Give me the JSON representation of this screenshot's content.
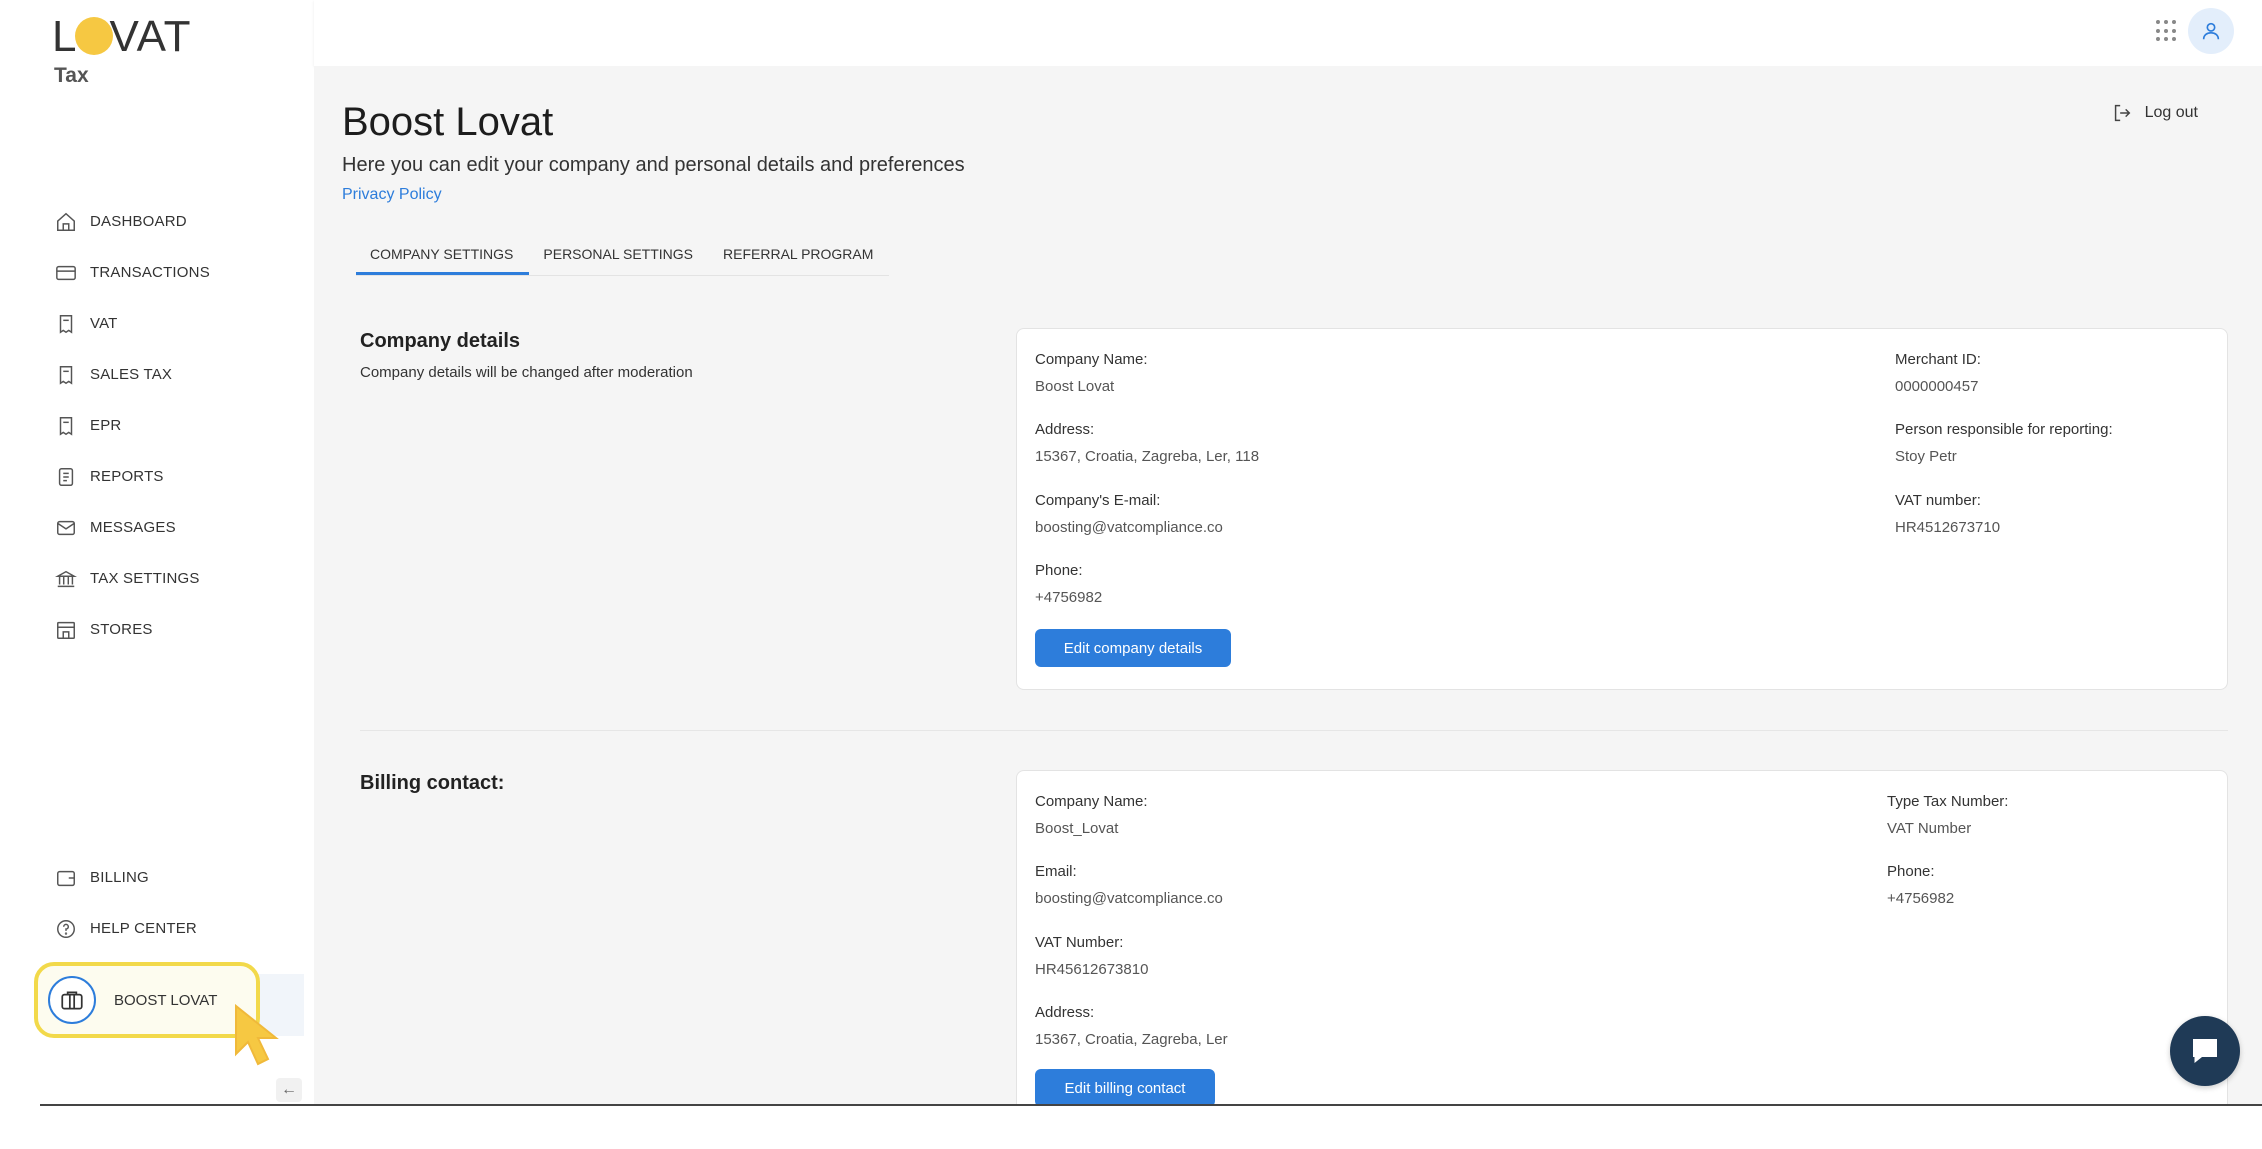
{
  "brand": {
    "logo_text_left": "L",
    "logo_text_right": "VAT",
    "product": "Tax",
    "accent": "#2d7ddb",
    "logo_color": "#f6c842"
  },
  "sidebar": {
    "items": [
      {
        "label": "DASHBOARD",
        "icon": "home-icon"
      },
      {
        "label": "TRANSACTIONS",
        "icon": "card-icon"
      },
      {
        "label": "VAT",
        "icon": "vat-receipt-icon"
      },
      {
        "label": "SALES TAX",
        "icon": "tax-receipt-icon"
      },
      {
        "label": "EPR",
        "icon": "epr-receipt-icon"
      },
      {
        "label": "REPORTS",
        "icon": "document-icon"
      },
      {
        "label": "MESSAGES",
        "icon": "envelope-icon"
      },
      {
        "label": "TAX SETTINGS",
        "icon": "bank-icon"
      },
      {
        "label": "STORES",
        "icon": "store-icon"
      }
    ],
    "bottom_items": [
      {
        "label": "BILLING",
        "icon": "wallet-icon"
      },
      {
        "label": "HELP CENTER",
        "icon": "help-icon"
      }
    ],
    "profile": {
      "label": "BOOST LOVAT",
      "icon": "briefcase-icon"
    },
    "collapse_icon": "arrow-left-icon",
    "collapse_glyph": "←"
  },
  "topbar": {
    "apps_icon": "apps-grid-icon",
    "avatar_icon": "user-icon"
  },
  "page": {
    "title": "Boost Lovat",
    "subtitle": "Here you can edit your company and personal details and preferences",
    "privacy_link": "Privacy Policy",
    "logout": "Log out"
  },
  "tabs": [
    {
      "label": "COMPANY SETTINGS",
      "active": true
    },
    {
      "label": "PERSONAL SETTINGS",
      "active": false
    },
    {
      "label": "REFERRAL PROGRAM",
      "active": false
    }
  ],
  "company": {
    "title": "Company details",
    "description": "Company details will be changed after moderation",
    "fields": {
      "name_label": "Company Name:",
      "name": "Boost Lovat",
      "address_label": "Address:",
      "address": "15367, Croatia, Zagreba, Ler, 118",
      "email_label": "Company's E-mail:",
      "email": "boosting@vatcompliance.co",
      "phone_label": "Phone:",
      "phone": "+4756982",
      "merchant_label": "Merchant ID:",
      "merchant": "0000000457",
      "person_label": "Person responsible for reporting:",
      "person": "Stoy Petr",
      "vat_label": "VAT number:",
      "vat": "HR4512673710"
    },
    "edit_button": "Edit company details"
  },
  "billing": {
    "title": "Billing contact:",
    "fields": {
      "name_label": "Company Name:",
      "name": "Boost_Lovat",
      "email_label": "Email:",
      "email": "boosting@vatcompliance.co",
      "vat_label": "VAT Number:",
      "vat": "HR45612673810",
      "address_label": "Address:",
      "address": "15367, Croatia, Zagreba, Ler",
      "type_label": "Type Tax Number:",
      "type": "VAT Number",
      "phone_label": "Phone:",
      "phone": "+4756982"
    },
    "edit_button": "Edit billing contact"
  }
}
